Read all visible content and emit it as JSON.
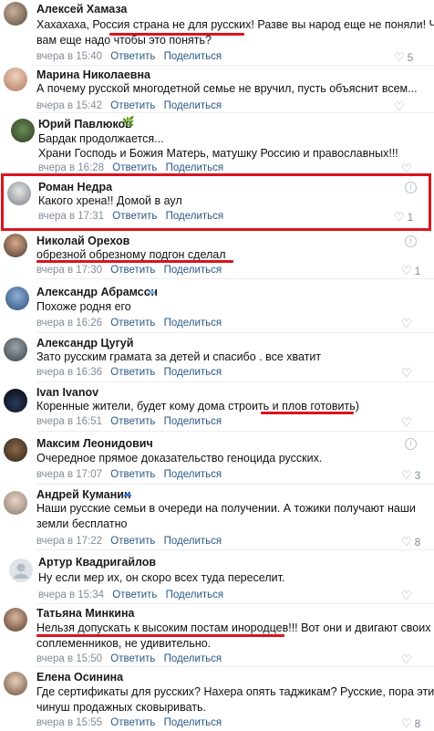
{
  "comments": [
    {
      "author": "Алексей Хамаза",
      "lines": [
        "Хахахаха, Россия страна не для русских! Разве вы народ еще не поняли! Че",
        "вам еще надо чтобы это понять?"
      ],
      "time": "вчера в 15:40",
      "reply": "Ответить",
      "share": "Поделиться",
      "likes": "5"
    },
    {
      "author": "Марина Николаевна",
      "lines": [
        "А почему русской многодетной семье не вручил, пусть объяснит всем..."
      ],
      "time": "вчера в 15:42",
      "reply": "Ответить",
      "share": "Поделиться",
      "likes": ""
    },
    {
      "author": "Юрий Павлюков",
      "lines": [
        "Бардак продолжается...",
        "Храни Господь и Божия Матерь, матушку Россию и православных!!!"
      ],
      "time": "вчера в 16:28",
      "reply": "Ответить",
      "share": "Поделиться",
      "likes": ""
    },
    {
      "author": "Роман Недра",
      "lines": [
        "Какого хрена!! Домой в аул"
      ],
      "time": "вчера в 17:31",
      "reply": "Ответить",
      "share": "Поделиться",
      "likes": "1"
    },
    {
      "author": "Николай Орехов",
      "lines": [
        "обрезной обрезному подгон сделал"
      ],
      "time": "вчера в 17:30",
      "reply": "Ответить",
      "share": "Поделиться",
      "likes": "1"
    },
    {
      "author": "Александр Абрамсон",
      "lines": [
        "Похоже родня его"
      ],
      "time": "вчера в 16:26",
      "reply": "Ответить",
      "share": "Поделиться",
      "likes": ""
    },
    {
      "author": "Александр Цугуй",
      "lines": [
        "Зато русским грамата за детей и спасибо . все хватит"
      ],
      "time": "вчера в 16:36",
      "reply": "Ответить",
      "share": "Поделиться",
      "likes": ""
    },
    {
      "author": "Ivan Ivanov",
      "lines": [
        "Коренные жители, будет кому дома строить и плов готовить)"
      ],
      "time": "вчера в 16:51",
      "reply": "Ответить",
      "share": "Поделиться",
      "likes": ""
    },
    {
      "author": "Максим Леонидович",
      "lines": [
        "Очередное прямое доказательство геноцида русских."
      ],
      "time": "вчера в 17:07",
      "reply": "Ответить",
      "share": "Поделиться",
      "likes": "3"
    },
    {
      "author": "Андрей Куманин",
      "lines": [
        "Наши русские семьи в очереди на получении. А тожики получают наши",
        "земли бесплатно"
      ],
      "time": "вчера в 17:22",
      "reply": "Ответить",
      "share": "Поделиться",
      "likes": "8"
    },
    {
      "author": "Артур Квадригайлов",
      "lines": [
        "Ну если мер их, он скоро всех туда переселит."
      ],
      "time": "вчера в 15:34",
      "reply": "Ответить",
      "share": "Поделиться",
      "likes": ""
    },
    {
      "author": "Татьяна Минкина",
      "lines": [
        "Нельзя допускать к высоким постам инородцев!!! Вот они и двигают своих",
        "соплеменников, не удивительно."
      ],
      "time": "вчера в 15:50",
      "reply": "Ответить",
      "share": "Поделиться",
      "likes": ""
    },
    {
      "author": "Елена Осинина",
      "lines": [
        "Где сертификаты для русских? Нахера опять таджикам? Русские, пора этих",
        "чинуш продажных сковыривать."
      ],
      "time": "вчера в 15:55",
      "reply": "Ответить",
      "share": "Поделиться",
      "likes": "8"
    }
  ],
  "icons": {
    "more": "info-circle-icon",
    "like": "heart-icon",
    "leaf": "leaf-badge-icon",
    "cloud": "cloud-badge-icon",
    "avatar": "user-placeholder-icon"
  },
  "colors": {
    "highlight": "#d9141e",
    "link": "#2a5885",
    "meta": "#818c99"
  }
}
